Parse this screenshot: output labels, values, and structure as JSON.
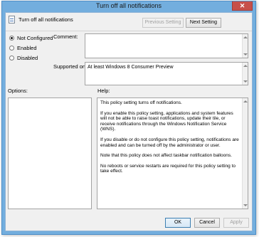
{
  "window": {
    "title": "Turn off all notifications",
    "close_glyph": "✕"
  },
  "header": {
    "icon": "policy-setting-icon",
    "title": "Turn off all notifications",
    "previous_label": "Previous Setting",
    "next_label": "Next Setting"
  },
  "state": {
    "options": [
      {
        "label": "Not Configured",
        "checked": true
      },
      {
        "label": "Enabled",
        "checked": false
      },
      {
        "label": "Disabled",
        "checked": false
      }
    ]
  },
  "comment": {
    "label": "Comment:",
    "value": ""
  },
  "supported": {
    "label": "Supported on:",
    "value": "At least Windows 8 Consumer Preview"
  },
  "options_panel": {
    "label": "Options:"
  },
  "help_panel": {
    "label": "Help:",
    "paragraphs": [
      "This policy setting turns off notifications.",
      "If you enable this policy setting, applications and system features will not be able to raise toast notifications, update their tile, or receive notifications through the Windows Notification Service (WNS).",
      "If you disable or do not configure this policy setting, notifications are enabled and can be turned off by the administrator or user.",
      "Note that this policy does not affect taskbar notification balloons.",
      "No reboots or service restarts are required for this policy setting to take effect."
    ]
  },
  "footer": {
    "ok_label": "OK",
    "cancel_label": "Cancel",
    "apply_label": "Apply"
  },
  "colors": {
    "title_bar": "#73aede",
    "close_button": "#c7504a",
    "focus_border": "#3c7fb1"
  }
}
